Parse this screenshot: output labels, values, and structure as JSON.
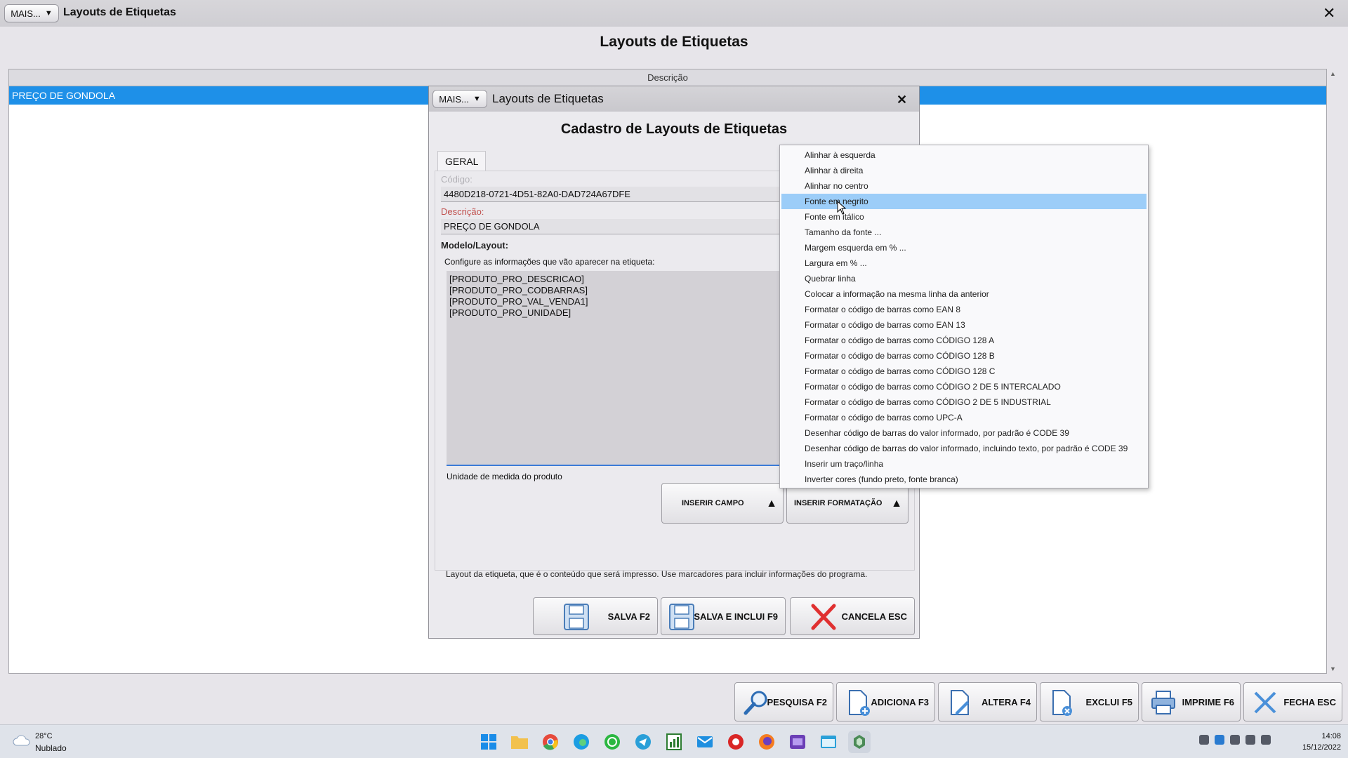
{
  "main_window": {
    "mais_label": "MAIS...",
    "title": "Layouts de Etiquetas",
    "page_title": "Layouts de Etiquetas",
    "grid": {
      "column_header": "Descrição",
      "rows": [
        "PREÇO DE GONDOLA"
      ]
    },
    "toolbar": [
      {
        "label": "PESQUISA F2",
        "icon": "search-icon"
      },
      {
        "label": "ADICIONA F3",
        "icon": "document-add-icon"
      },
      {
        "label": "ALTERA F4",
        "icon": "document-edit-icon"
      },
      {
        "label": "EXCLUI F5",
        "icon": "document-delete-icon"
      },
      {
        "label": "IMPRIME F6",
        "icon": "printer-icon"
      },
      {
        "label": "FECHA ESC",
        "icon": "close-icon"
      }
    ]
  },
  "dialog": {
    "mais_label": "MAIS...",
    "title": "Layouts de Etiquetas",
    "heading": "Cadastro de Layouts de Etiquetas",
    "tab": "GERAL",
    "codigo_label": "Código:",
    "codigo_value": "4480D218-0721-4D51-82A0-DAD724A67DFE",
    "descricao_label": "Descrição:",
    "descricao_value": "PREÇO DE GONDOLA",
    "modelo_label": "Modelo/Layout:",
    "configure_hint": "Configure as informações que vão aparecer na etiqueta:",
    "layout_lines": [
      "[PRODUTO_PRO_DESCRICAO]",
      "[PRODUTO_PRO_CODBARRAS]",
      "[PRODUTO_PRO_VAL_VENDA1]",
      "[PRODUTO_PRO_UNIDADE]"
    ],
    "field_description": "Unidade de medida do produto",
    "inserir_campo": "INSERIR CAMPO",
    "inserir_formatacao": "INSERIR FORMATAÇÃO",
    "footer_note": "Layout da etiqueta, que é o conteúdo que será impresso. Use marcadores para incluir informações do programa.",
    "buttons": {
      "salva": "SALVA F2",
      "salva_inclui": "SALVA E INCLUI F9",
      "cancela": "CANCELA ESC"
    }
  },
  "context_menu": {
    "highlighted_index": 3,
    "items": [
      "Alinhar à esquerda",
      "Alinhar à direita",
      "Alinhar no centro",
      "Fonte em negrito",
      "Fonte em itálico",
      "Tamanho da fonte ...",
      "Margem esquerda em % ...",
      "Largura em % ...",
      "Quebrar linha",
      "Colocar a informação na mesma linha da anterior",
      "Formatar o código de barras como EAN 8",
      "Formatar o código de barras como EAN 13",
      "Formatar o código de barras como CÓDIGO 128 A",
      "Formatar o código de barras como CÓDIGO 128 B",
      "Formatar o código de barras como CÓDIGO 128 C",
      "Formatar o código de barras como CÓDIGO 2 DE 5 INTERCALADO",
      "Formatar o código de barras como CÓDIGO 2 DE 5 INDUSTRIAL",
      "Formatar o código de barras como UPC-A",
      "Desenhar código de barras do valor informado, por padrão é CODE 39",
      "Desenhar código de barras do valor informado, incluindo texto, por padrão é CODE 39",
      "Inserir um traço/linha",
      "Inverter cores (fundo preto, fonte branca)"
    ]
  },
  "taskbar": {
    "weather_temp": "28°C",
    "weather_desc": "Nublado",
    "time": "14:08",
    "date": "15/12/2022",
    "apps": [
      "windows-start-icon",
      "file-explorer-icon",
      "chrome-icon",
      "edge-icon",
      "whatsapp-icon",
      "telegram-icon",
      "spreadsheet-icon",
      "mail-icon",
      "app-red-icon",
      "firefox-icon",
      "media-icon",
      "window-icon",
      "system-app-icon"
    ]
  },
  "colors": {
    "selection_blue": "#1e90e8",
    "menu_highlight": "#9ccdf8",
    "required_label": "#c0504d",
    "cancel_red": "#e03030"
  }
}
